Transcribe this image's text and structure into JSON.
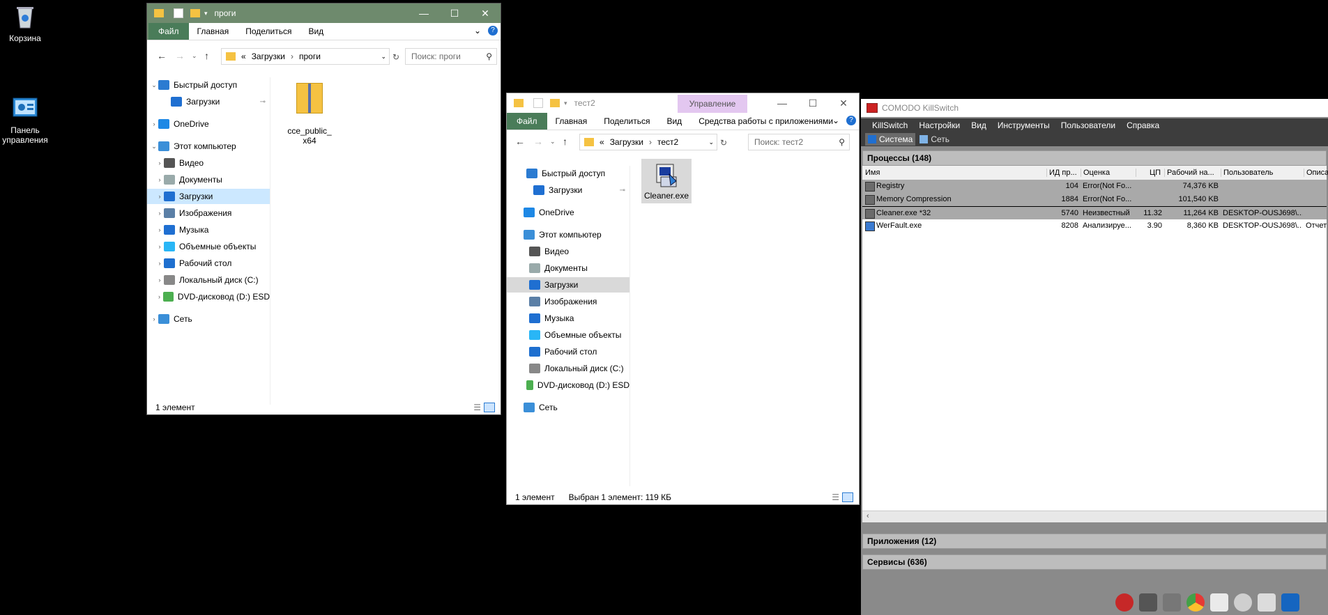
{
  "desktop": {
    "icons": [
      {
        "label": "Корзина",
        "icon": "recycle-bin-icon"
      },
      {
        "label": "Панель\nуправления",
        "icon": "control-panel-icon"
      }
    ]
  },
  "explorer1": {
    "title": "проги",
    "ribbon_tabs": [
      "Файл",
      "Главная",
      "Поделиться",
      "Вид"
    ],
    "address": [
      "«",
      "Загрузки",
      "›",
      "проги"
    ],
    "search_placeholder": "Поиск: проги",
    "tree": [
      {
        "label": "Быстрый доступ",
        "icon": "star-icon"
      },
      {
        "label": "Загрузки",
        "icon": "download-icon"
      },
      {
        "label": "OneDrive",
        "icon": "cloud-icon"
      },
      {
        "label": "Этот компьютер",
        "icon": "computer-icon"
      },
      {
        "label": "Видео",
        "icon": "video-icon"
      },
      {
        "label": "Документы",
        "icon": "documents-icon"
      },
      {
        "label": "Загрузки",
        "icon": "download-icon"
      },
      {
        "label": "Изображения",
        "icon": "pictures-icon"
      },
      {
        "label": "Музыка",
        "icon": "music-icon"
      },
      {
        "label": "Объемные объекты",
        "icon": "3d-objects-icon"
      },
      {
        "label": "Рабочий стол",
        "icon": "desktop-icon"
      },
      {
        "label": "Локальный диск (C:)",
        "icon": "drive-icon"
      },
      {
        "label": "DVD-дисковод (D:) ESD",
        "icon": "dvd-icon"
      },
      {
        "label": "Сеть",
        "icon": "network-icon"
      }
    ],
    "files": [
      {
        "label": "cce_public_\nx64",
        "icon": "folder-zip-icon"
      }
    ],
    "status": "1 элемент"
  },
  "explorer2": {
    "title": "тест2",
    "context_tab": "Управление",
    "ribbon_tabs": [
      "Файл",
      "Главная",
      "Поделиться",
      "Вид",
      "Средства работы с приложениями"
    ],
    "address": [
      "«",
      "Загрузки",
      "›",
      "тест2"
    ],
    "search_placeholder": "Поиск: тест2",
    "tree": [
      {
        "label": "Быстрый доступ",
        "icon": "star-icon"
      },
      {
        "label": "Загрузки",
        "icon": "download-icon"
      },
      {
        "label": "OneDrive",
        "icon": "cloud-icon"
      },
      {
        "label": "Этот компьютер",
        "icon": "computer-icon"
      },
      {
        "label": "Видео",
        "icon": "video-icon"
      },
      {
        "label": "Документы",
        "icon": "documents-icon"
      },
      {
        "label": "Загрузки",
        "icon": "download-icon"
      },
      {
        "label": "Изображения",
        "icon": "pictures-icon"
      },
      {
        "label": "Музыка",
        "icon": "music-icon"
      },
      {
        "label": "Объемные объекты",
        "icon": "3d-objects-icon"
      },
      {
        "label": "Рабочий стол",
        "icon": "desktop-icon"
      },
      {
        "label": "Локальный диск (C:)",
        "icon": "drive-icon"
      },
      {
        "label": "DVD-дисковод (D:) ESD",
        "icon": "dvd-icon"
      },
      {
        "label": "Сеть",
        "icon": "network-icon"
      }
    ],
    "files": [
      {
        "label": "Cleaner.exe",
        "icon": "installer-icon"
      }
    ],
    "status": "1 элемент",
    "status_selected": "Выбран 1 элемент: 119 КБ"
  },
  "killswitch": {
    "title": "COMODO KillSwitch",
    "menu": [
      "KillSwitch",
      "Настройки",
      "Вид",
      "Инструменты",
      "Пользователи",
      "Справка"
    ],
    "toolbar": [
      "Система",
      "Сеть"
    ],
    "processes_header": "Процессы (148)",
    "columns": [
      "Имя",
      "ИД пр...",
      "Оценка",
      "ЦП",
      "Рабочий на...",
      "Пользователь",
      "Описа"
    ],
    "rows": [
      {
        "name": "Registry",
        "pid": "104",
        "rating": "Error(Not Fo...",
        "cpu": "",
        "ws": "74,376 KB",
        "user": "",
        "desc": ""
      },
      {
        "name": "Memory Compression",
        "pid": "1884",
        "rating": "Error(Not Fo...",
        "cpu": "",
        "ws": "101,540 KB",
        "user": "",
        "desc": ""
      },
      {
        "name": "Cleaner.exe *32",
        "pid": "5740",
        "rating": "Неизвестный",
        "cpu": "11.32",
        "ws": "11,264 KB",
        "user": "DESKTOP-OUSJ698\\...",
        "desc": ""
      },
      {
        "name": "WerFault.exe",
        "pid": "8208",
        "rating": "Анализируе...",
        "cpu": "3.90",
        "ws": "8,360 KB",
        "user": "DESKTOP-OUSJ698\\...",
        "desc": "Отчет"
      }
    ],
    "applications_header": "Приложения (12)",
    "services_header": "Сервисы (636)"
  },
  "colors": {
    "explorer1_title": "#6e8a6d",
    "ribbon_file": "#4a7c59",
    "selection": "#cce8ff",
    "context_tab": "#e3c7f0"
  }
}
